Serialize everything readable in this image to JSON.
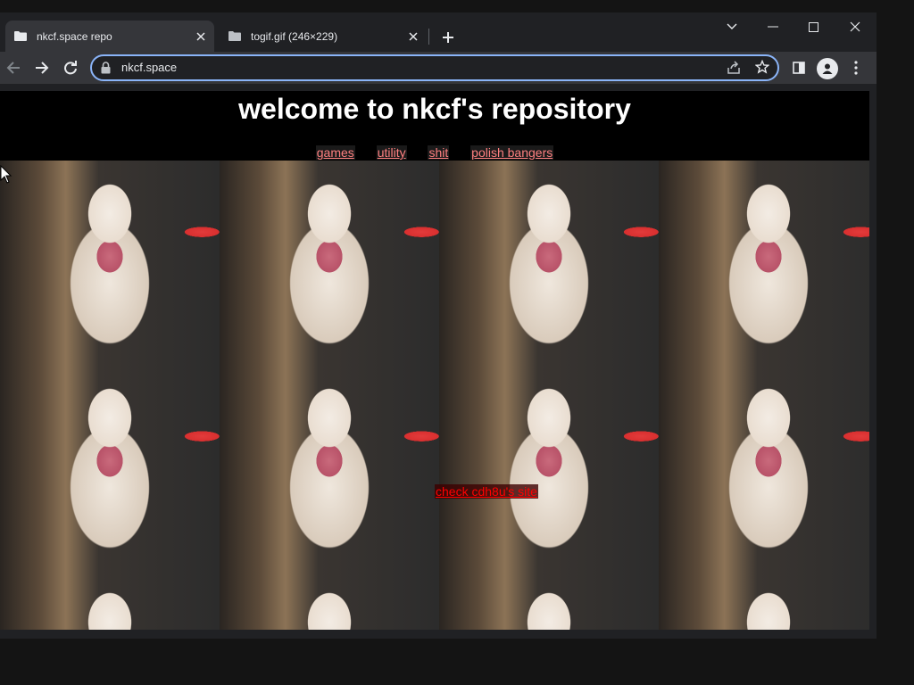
{
  "browser": {
    "tabs": [
      {
        "title": "nkcf.space repo",
        "active": true
      },
      {
        "title": "togif.gif (246×229)",
        "active": false
      }
    ],
    "url": "nkcf.space",
    "icons": {
      "back": "arrow-left-icon",
      "forward": "arrow-right-icon",
      "reload": "reload-icon",
      "lock": "lock-icon",
      "share": "share-icon",
      "bookmark": "star-icon",
      "sidepanel": "side-panel-icon",
      "profile": "profile-icon",
      "menu": "kebab-menu-icon",
      "tab_search": "chevron-down-icon",
      "minimize": "minimize-icon",
      "maximize": "maximize-icon",
      "close": "close-icon",
      "new_tab": "plus-icon"
    },
    "colors": {
      "frame": "#202124",
      "toolbar": "#35363a",
      "omnibox_border": "#8ab4f8"
    }
  },
  "page": {
    "title": "welcome to nkcf's repository",
    "nav": [
      {
        "label": "games"
      },
      {
        "label": "utility"
      },
      {
        "label": "shit"
      },
      {
        "label": "polish bangers"
      }
    ],
    "link": "check cdh8u's site",
    "background": "tiled cat gif",
    "colors": {
      "title": "#ffffff",
      "nav_link": "#ff8080",
      "site_link": "#ff0000",
      "header_bg": "#000000"
    }
  }
}
